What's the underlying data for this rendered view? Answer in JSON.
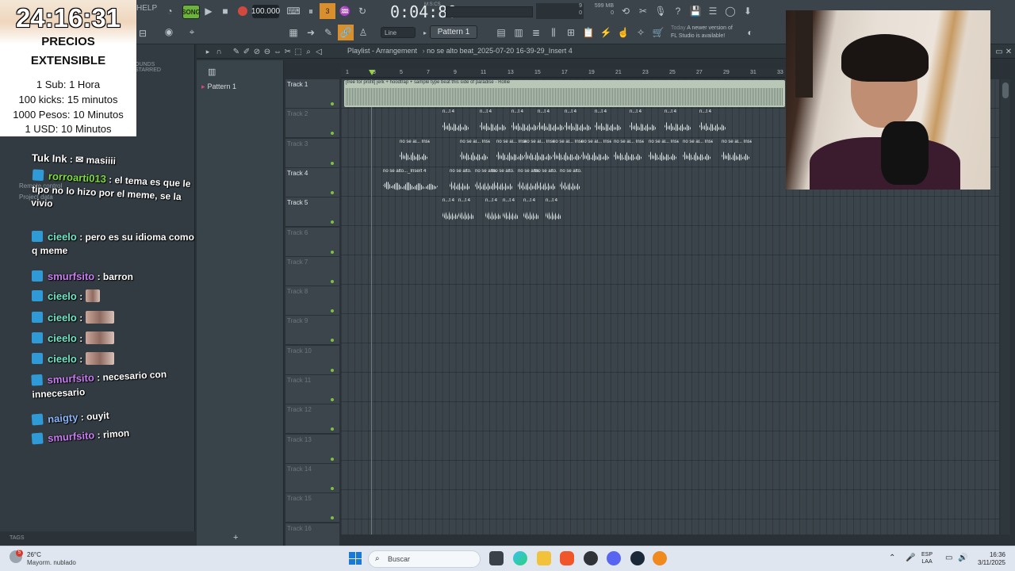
{
  "toolbar": {
    "help": "HELP",
    "song": "SONG",
    "tempo": "100.000",
    "time": "0:04:80",
    "time_unit": "M:S:CS",
    "cpu": "9",
    "cpu_val": "0",
    "memory": "599 MB",
    "memory_val": "0",
    "snap": "Line",
    "pattern": "Pattern 1",
    "news_today": "Today",
    "news_text_1": "A newer version of",
    "news_text_2": "FL Studio is available!"
  },
  "overlay": {
    "clock": "24:16:31",
    "title": "PRECIOS",
    "subtitle": "EXTENSIBLE",
    "lines": [
      "1 Sub: 1 Hora",
      "100 kicks: 15 minutos",
      "1000 Pesos: 10 Minutos",
      "1 USD: 10 Minutos"
    ]
  },
  "browser": {
    "tab_sounds": "OUNDS",
    "tab_starred": "STARRED",
    "remote_control": "Remote control",
    "project_data": "Project data",
    "tags": "TAGS"
  },
  "chat": [
    {
      "user": "Tuk Ink",
      "text": ": ✉ masiiii"
    },
    {
      "user": "rorroarti013",
      "text": ": el tema es que le tipo no lo hizo por el meme, se la vivio"
    },
    {
      "user": "cieelo",
      "text": ": pero es su idioma como q meme"
    },
    {
      "user": "smurfsito",
      "text": ": barron"
    },
    {
      "user": "cieelo",
      "text": ":"
    },
    {
      "user": "cieelo",
      "text": ":"
    },
    {
      "user": "cieelo",
      "text": ":"
    },
    {
      "user": "cieelo",
      "text": ":"
    },
    {
      "user": "smurfsito",
      "text": ": necesario con innecesario"
    },
    {
      "user": "naigty",
      "text": ": ouyit"
    },
    {
      "user": "smurfsito",
      "text": ": rimon"
    }
  ],
  "pattern_panel": {
    "pattern_item": "Pattern 1"
  },
  "playlist": {
    "title": "Playlist - Arrangement",
    "breadcrumb": "no se alto beat_2025-07-20 16-39-29_Insert 4",
    "bar_numbers": [
      "1",
      "3",
      "5",
      "7",
      "9",
      "11",
      "13",
      "15",
      "17",
      "19",
      "21",
      "23",
      "25",
      "27",
      "29",
      "31",
      "33"
    ],
    "tracks": [
      "Track 1",
      "Track 2",
      "Track 3",
      "Track 4",
      "Track 5",
      "Track 6",
      "Track 7",
      "Track 8",
      "Track 9",
      "Track 10",
      "Track 11",
      "Track 12",
      "Track 13",
      "Track 14",
      "Track 15",
      "Track 16"
    ],
    "clip_main": "[free for profit] jerk + hoodtrap + sample type beat this side of paradise - Rollie",
    "clip_t2": "n...t 4",
    "clip_t3": "no se al... Insert 4",
    "clip_t4": "no se alto..._Insert 4",
    "clip_t5": "n...t 4"
  },
  "taskbar": {
    "temp": "26°C",
    "weather": "Mayorm. nublado",
    "badge": "5",
    "search": "Buscar",
    "lang_1": "ESP",
    "lang_2": "LAA",
    "time": "16:36",
    "date": "3/11/2025"
  }
}
